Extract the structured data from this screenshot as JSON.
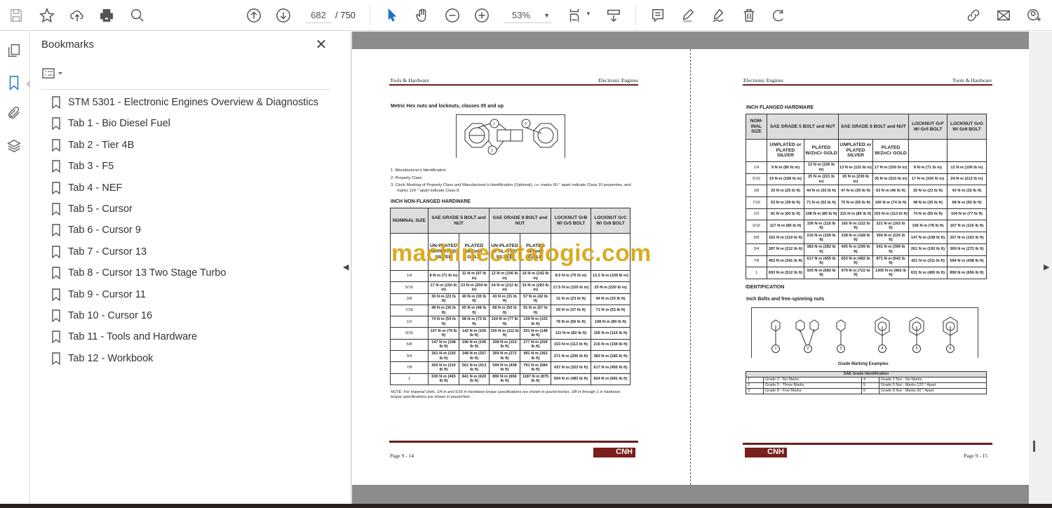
{
  "toolbar": {
    "page_current": "682",
    "page_total": "/ 750",
    "zoom": "53%"
  },
  "bookmarks": {
    "title": "Bookmarks",
    "items": [
      "STM 5301 - Electronic Engines Overview & Diagnostics",
      "Tab 1 - Bio Diesel Fuel",
      "Tab 2 - Tier 4B",
      "Tab 3 - F5",
      "Tab 4 - NEF",
      "Tab 5 - Cursor",
      "Tab 6 - Cursor 9",
      "Tab 7 - Cursor 13",
      "Tab 8 - Cursor 13 Two Stage Turbo",
      "Tab 9 - Cursor 11",
      "Tab 10 - Cursor 16",
      "Tab 11 - Tools and Hardware",
      "Tab 12 - Workbook"
    ]
  },
  "watermark": "machinecatalogic.com",
  "left_page": {
    "header_left": "Tools & Hardware",
    "header_right": "Electronic Engines",
    "section_title": "Metric Hex nuts and locknuts, classes 05 and up",
    "list": [
      "1.  Manufacturer's Identification",
      "2.  Property Class",
      "3.  Clock Marking of Property Class and Manufacturer's Identification (Optional), i.e. marks 60 ° apart indicate Class 10 properties, and marks 120 ° apart indicate Class 8."
    ],
    "table_title": "INCH NON-FLANGED HARDWARE",
    "headers": [
      "NOMINAL SIZE",
      "SAE GRADE 5 BOLT and NUT",
      "SAE GRADE 8 BOLT and NUT",
      "LOCKNUT GrB W/ Gr5 BOLT",
      "LOCKNUT GrC W/ Gr8 BOLT"
    ],
    "subheaders": [
      "UN-PLATED or PLATED SILVER",
      "PLATED W/ZnCr GOLD",
      "UN-PLATED or PLATED SILVER",
      "PLATED W/ZnCr GOLD"
    ],
    "rows": [
      [
        "1/4",
        "8 N·m (71 lb in)",
        "11 N·m (97 lb in)",
        "12 N·m (106 lb in)",
        "16 N·m (142 lb in)",
        "8.5 N·m (75 lb in)",
        "12.2 N·m (109 lb in)"
      ],
      [
        "5/16",
        "17 N·m (150 lb in)",
        "23 N·m (204 lb in)",
        "24 N·m (212 lb in)",
        "32 N·m (283 lb in)",
        "17.5 N·m (155 lb in)",
        "25 N·m (220 lb in)"
      ],
      [
        "3/8",
        "30 N·m (22 lb ft)",
        "40 N·m (30 lb ft)",
        "43 N·m (31 lb ft)",
        "57 N·m (42 lb ft)",
        "31 N·m (23 lb ft)",
        "44 N·m (33 lb ft)"
      ],
      [
        "7/16",
        "48 N·m (36 lb ft)",
        "65 N·m (48 lb ft)",
        "68 N·m (50 lb ft)",
        "91 N·m (67 lb ft)",
        "50 N·m (37 lb ft)",
        "71 N·m (53 lb ft)"
      ],
      [
        "1/2",
        "74 N·m (54 lb ft)",
        "98 N·m (73 lb ft)",
        "104 N·m (77 lb ft)",
        "139 N·m (103 lb ft)",
        "76 N·m (56 lb ft)",
        "108 N·m (80 lb ft)"
      ],
      [
        "9/16",
        "107 N·m (79 lb ft)",
        "142 N·m (105 lb ft)",
        "150 N·m (111 lb ft)",
        "201 N·m (148 lb ft)",
        "111 N·m (82 lb ft)",
        "156 N·m (115 lb ft)"
      ],
      [
        "5/8",
        "147 N·m (108 lb ft)",
        "196 N·m (145 lb ft)",
        "208 N·m (153 lb ft)",
        "277 N·m (204 lb ft)",
        "153 N·m (113 lb ft)",
        "215 N·m (159 lb ft)"
      ],
      [
        "3/4",
        "261 N·m (193 lb ft)",
        "348 N·m (257 lb ft)",
        "369 N·m (272 lb ft)",
        "491 N·m (362 lb ft)",
        "271 N·m (200 lb ft)",
        "383 N·m (282 lb ft)"
      ],
      [
        "7/8",
        "420 N·m (310 lb ft)",
        "561 N·m (413 lb ft)",
        "594 N·m (438 lb ft)",
        "791 N·m (584 lb ft)",
        "437 N·m (323 lb ft)",
        "617 N·m (455 lb ft)"
      ],
      [
        "1",
        "630 N·m (465 lb ft)",
        "841 N·m (620 lb ft)",
        "890 N·m (656 lb ft)",
        "1187 N·m (875 lb ft)",
        "654 N·m (483 lb ft)",
        "924 N·m (681 lb ft)"
      ]
    ],
    "note": "NOTE: For Imperial Units, 1/4 in and 5/16 in hardware torque specifications are shown in pound-inches. 3/8 in through 1 in hardware torque specifications are shown in pound-feet.",
    "footer": "Page 9 - 14",
    "logo": "CNH"
  },
  "right_page": {
    "header_left": "Electronic Engines",
    "header_right": "Tools & Hardware",
    "table_title": "INCH FLANGED HARDWARE",
    "headers": [
      "NOM-INAL SIZE",
      "SAE GRADE 5 BOLT and NUT",
      "SAE GRADE 8 BOLT and NUT",
      "LOCKNUT GrF W/ Gr5 BOLT",
      "LOCKNUT GrG W/ Gr8 BOLT"
    ],
    "subheaders": [
      "UNPLATED or PLATED SILVER",
      "PLATED W/ZnCr GOLD",
      "UNPLATED or PLATED SILVER",
      "PLATED W/ZnCr GOLD"
    ],
    "rows": [
      [
        "1/4",
        "9 N·m (80 lb in)",
        "12 N·m (106 lb in)",
        "13 N·m (115 lb in)",
        "17 N·m (150 lb in)",
        "8 N·m (71 lb in)",
        "12 N·m (106 lb in)"
      ],
      [
        "5/16",
        "19 N·m (168 lb in)",
        "25 N·m (221 lb in)",
        "26 N·m (230 lb in)",
        "35 N·m (310 lb in)",
        "17 N·m (150 lb in)",
        "24 N·m (212 lb in)"
      ],
      [
        "3/8",
        "33 N·m (25 lb ft)",
        "44 N·m (33 lb ft)",
        "47 N·m (35 lb ft)",
        "63 N·m (46 lb ft)",
        "30 N·m (22 lb ft)",
        "43 N·m (32 lb ft)"
      ],
      [
        "7/16",
        "53 N·m (39 lb ft)",
        "71 N·m (52 lb ft)",
        "75 N·m (55 lb ft)",
        "100 N·m (74 lb ft)",
        "48 N·m (35 lb ft)",
        "68 N·m (50 lb ft)"
      ],
      [
        "1/2",
        "81 N·m (60 lb ft)",
        "108 N·m (80 lb ft)",
        "115 N·m (85 lb ft)",
        "153 N·m (113 lb ft)",
        "74 N·m (55 lb ft)",
        "104 N·m (77 lb ft)"
      ],
      [
        "9/16",
        "117 N·m (86 lb ft)",
        "156 N·m (115 lb ft)",
        "165 N·m (122 lb ft)",
        "221 N·m (163 lb ft)",
        "106 N·m (78 lb ft)",
        "157 N·m (116 lb ft)"
      ],
      [
        "5/8",
        "162 N·m (119 lb ft)",
        "216 N·m (159 lb ft)",
        "228 N·m (168 lb ft)",
        "304 N·m (225 lb ft)",
        "147 N·m (108 lb ft)",
        "207 N·m (153 lb ft)"
      ],
      [
        "3/4",
        "287 N·m (212 lb ft)",
        "383 N·m (282 lb ft)",
        "405 N·m (299 lb ft)",
        "541 N·m (399 lb ft)",
        "261 N·m (193 lb ft)",
        "369 N·m (272 lb ft)"
      ],
      [
        "7/8",
        "462 N·m (341 lb ft)",
        "617 N·m (455 lb ft)",
        "653 N·m (482 lb ft)",
        "871 N·m (642 lb ft)",
        "421 N·m (311 lb ft)",
        "594 N·m (438 lb ft)"
      ],
      [
        "1",
        "693 N·m (512 lb ft)",
        "925 N·m (682 lb ft)",
        "979 N·m (722 lb ft)",
        "1305 N·m (963 lb ft)",
        "631 N·m (465 lb ft)",
        "890 N·m (656 lb ft)"
      ]
    ],
    "ident_title": "IDENTIFICATION",
    "ident_sub": "Inch Bolts and free-spinning nuts",
    "figure_caption": "Grade Marking Examples",
    "callouts": [
      "1",
      "2",
      "3",
      "4",
      "5",
      "6"
    ],
    "sae_title": "SAE Grade Identification",
    "sae_rows": [
      [
        "1",
        "Grade 2 - No Marks",
        "4",
        "Grade 2 Nut - No Marks"
      ],
      [
        "2",
        "Grade 5 - Three Marks",
        "5",
        "Grade 5 Nut - Marks 120 ° Apart"
      ],
      [
        "3",
        "Grade 8 - Five Marks",
        "6",
        "Grade 8 Nut - Marks 60 ° Apart"
      ]
    ],
    "footer": "Page 9 - 15",
    "logo": "CNH"
  }
}
